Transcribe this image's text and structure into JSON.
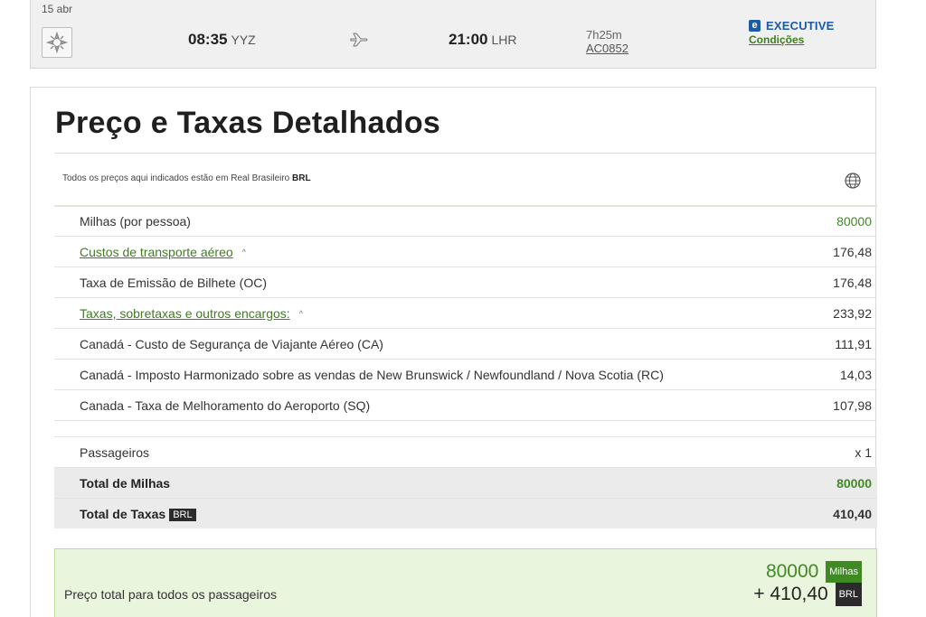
{
  "flight": {
    "date": "15 abr",
    "departure_time": "08:35",
    "departure_airport": "YYZ",
    "arrival_time": "21:00",
    "arrival_airport": "LHR",
    "duration": "7h25m",
    "flight_number": "AC0852",
    "cabin_badge": "e",
    "cabin": "EXECUTIVE",
    "conditions_label": "Condições"
  },
  "price": {
    "title": "Preço e Taxas Detalhados",
    "currency_note_prefix": "Todos os preços aqui indicados estão em Real Brasileiro",
    "currency_code": "BRL",
    "rows": [
      {
        "label": "Milhas (por pessoa)",
        "value": "80000"
      },
      {
        "label": "Custos de transporte aéreo",
        "value": "176,48"
      },
      {
        "label": "Taxa de Emissão de Bilhete (OC)",
        "value": "176,48"
      },
      {
        "label": "Taxas, sobretaxas e outros encargos:",
        "value": "233,92"
      },
      {
        "label": "Canadá - Custo de Segurança de Viajante Aéreo (CA)",
        "value": "111,91"
      },
      {
        "label": "Canadá - Imposto Harmonizado sobre as vendas de New Brunswick / Newfoundland / Nova Scotia (RC)",
        "value": "14,03"
      },
      {
        "label": "Canada - Taxa de Melhoramento do Aeroporto (SQ)",
        "value": "107,98"
      }
    ],
    "passengers_label": "Passageiros",
    "passengers_value": "x 1",
    "total_miles_label": "Total de Milhas",
    "total_miles_value": "80000",
    "total_taxes_label": "Total de Taxas",
    "total_taxes_tag": "BRL",
    "total_taxes_value": "410,40",
    "grand_total_label": "Preço total para todos os passageiros",
    "grand_total_miles": "80000",
    "grand_total_miles_unit": "Milhas",
    "grand_total_taxes": "+ 410,40",
    "grand_total_taxes_unit": "BRL"
  },
  "colors": {
    "accent_green": "#3f8a23",
    "link_green": "#3f7d1f",
    "executive_blue": "#1d5aa6",
    "total_box_bg": "#eaf5dd"
  },
  "icons": [
    "airline-logo-icon",
    "plane-icon",
    "caret-up-icon",
    "globe-money-icon"
  ]
}
